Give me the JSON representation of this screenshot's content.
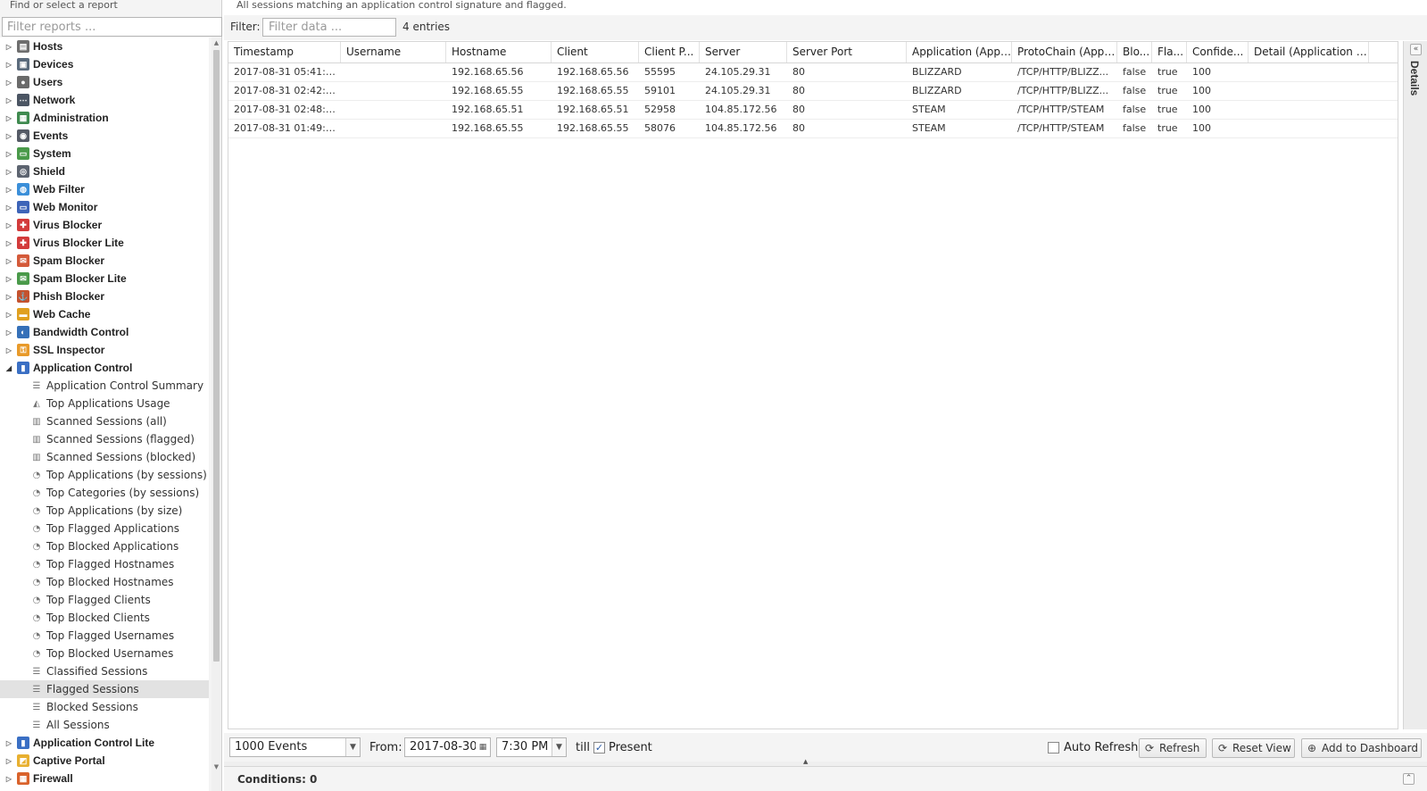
{
  "left_panel": {
    "header": "Find or select a report",
    "filter_placeholder": "Filter reports ..."
  },
  "tree_top": [
    {
      "label": "Hosts",
      "icon": "hosts-icon",
      "color": "#6e6e6e",
      "glyph": "▤"
    },
    {
      "label": "Devices",
      "icon": "devices-icon",
      "color": "#5b6b7c",
      "glyph": "▣"
    },
    {
      "label": "Users",
      "icon": "users-icon",
      "color": "#6a6a6a",
      "glyph": "●"
    },
    {
      "label": "Network",
      "icon": "network-icon",
      "color": "#4b5563",
      "glyph": "⋯"
    },
    {
      "label": "Administration",
      "icon": "administration-icon",
      "color": "#3f8a4f",
      "glyph": "▦"
    },
    {
      "label": "Events",
      "icon": "events-icon",
      "color": "#555b66",
      "glyph": "◉"
    },
    {
      "label": "System",
      "icon": "system-icon",
      "color": "#4a9a4a",
      "glyph": "▭"
    },
    {
      "label": "Shield",
      "icon": "shield-icon",
      "color": "#5d6470",
      "glyph": "◎"
    },
    {
      "label": "Web Filter",
      "icon": "web-filter-icon",
      "color": "#3b8fd9",
      "glyph": "◍"
    },
    {
      "label": "Web Monitor",
      "icon": "web-monitor-icon",
      "color": "#3d64b8",
      "glyph": "▭"
    },
    {
      "label": "Virus Blocker",
      "icon": "virus-blocker-icon",
      "color": "#d33b3b",
      "glyph": "✚"
    },
    {
      "label": "Virus Blocker Lite",
      "icon": "virus-blocker-lite-icon",
      "color": "#d33b3b",
      "glyph": "✚"
    },
    {
      "label": "Spam Blocker",
      "icon": "spam-blocker-icon",
      "color": "#d45a3a",
      "glyph": "✉"
    },
    {
      "label": "Spam Blocker Lite",
      "icon": "spam-blocker-lite-icon",
      "color": "#4a9a4a",
      "glyph": "✉"
    },
    {
      "label": "Phish Blocker",
      "icon": "phish-blocker-icon",
      "color": "#c4522e",
      "glyph": "⚓"
    },
    {
      "label": "Web Cache",
      "icon": "web-cache-icon",
      "color": "#e0a020",
      "glyph": "▬"
    },
    {
      "label": "Bandwidth Control",
      "icon": "bandwidth-control-icon",
      "color": "#3570b8",
      "glyph": "◐"
    },
    {
      "label": "SSL Inspector",
      "icon": "ssl-inspector-icon",
      "color": "#e89a2a",
      "glyph": "⚿"
    },
    {
      "label": "Application Control",
      "icon": "application-control-icon",
      "color": "#3a6fc4",
      "glyph": "▮",
      "expanded": true
    }
  ],
  "tree_children": [
    {
      "label": "Application Control Summary",
      "icon": "text-report-icon",
      "glyph": "☰"
    },
    {
      "label": "Top Applications Usage",
      "icon": "area-chart-icon",
      "glyph": "◭"
    },
    {
      "label": "Scanned Sessions (all)",
      "icon": "bar-chart-icon",
      "glyph": "▥"
    },
    {
      "label": "Scanned Sessions (flagged)",
      "icon": "bar-chart-icon",
      "glyph": "▥"
    },
    {
      "label": "Scanned Sessions (blocked)",
      "icon": "bar-chart-icon",
      "glyph": "▥"
    },
    {
      "label": "Top Applications (by sessions)",
      "icon": "pie-chart-icon",
      "glyph": "◔"
    },
    {
      "label": "Top Categories (by sessions)",
      "icon": "pie-chart-icon",
      "glyph": "◔"
    },
    {
      "label": "Top Applications (by size)",
      "icon": "pie-chart-icon",
      "glyph": "◔"
    },
    {
      "label": "Top Flagged Applications",
      "icon": "pie-chart-icon",
      "glyph": "◔"
    },
    {
      "label": "Top Blocked Applications",
      "icon": "pie-chart-icon",
      "glyph": "◔"
    },
    {
      "label": "Top Flagged Hostnames",
      "icon": "pie-chart-icon",
      "glyph": "◔"
    },
    {
      "label": "Top Blocked Hostnames",
      "icon": "pie-chart-icon",
      "glyph": "◔"
    },
    {
      "label": "Top Flagged Clients",
      "icon": "pie-chart-icon",
      "glyph": "◔"
    },
    {
      "label": "Top Blocked Clients",
      "icon": "pie-chart-icon",
      "glyph": "◔"
    },
    {
      "label": "Top Flagged Usernames",
      "icon": "pie-chart-icon",
      "glyph": "◔"
    },
    {
      "label": "Top Blocked Usernames",
      "icon": "pie-chart-icon",
      "glyph": "◔"
    },
    {
      "label": "Classified Sessions",
      "icon": "list-report-icon",
      "glyph": "☰"
    },
    {
      "label": "Flagged Sessions",
      "icon": "list-report-icon",
      "glyph": "☰",
      "selected": true
    },
    {
      "label": "Blocked Sessions",
      "icon": "list-report-icon",
      "glyph": "☰"
    },
    {
      "label": "All Sessions",
      "icon": "list-report-icon",
      "glyph": "☰"
    }
  ],
  "tree_bottom": [
    {
      "label": "Application Control Lite",
      "icon": "application-control-lite-icon",
      "color": "#3a6fc4",
      "glyph": "▮"
    },
    {
      "label": "Captive Portal",
      "icon": "captive-portal-icon",
      "color": "#e8b030",
      "glyph": "◩"
    },
    {
      "label": "Firewall",
      "icon": "firewall-icon",
      "color": "#d9622b",
      "glyph": "▦"
    }
  ],
  "report": {
    "description": "All sessions matching an application control signature and flagged.",
    "filter_label": "Filter:",
    "filter_placeholder": "Filter data ...",
    "entries": "4 entries"
  },
  "grid": {
    "columns": [
      "Timestamp",
      "Username",
      "Hostname",
      "Client",
      "Client P...",
      "Server",
      "Server Port",
      "Application (Appli...",
      "ProtoChain (Appli...",
      "Blo...",
      "Fla...",
      "Confide...",
      "Detail (Application C..."
    ],
    "rows": [
      [
        "2017-08-31 05:41:4...",
        "",
        "192.168.65.56",
        "192.168.65.56",
        "55595",
        "24.105.29.31",
        "80",
        "BLIZZARD",
        "/TCP/HTTP/BLIZZ...",
        "false",
        "true",
        "100",
        ""
      ],
      [
        "2017-08-31 02:42:5...",
        "",
        "192.168.65.55",
        "192.168.65.55",
        "59101",
        "24.105.29.31",
        "80",
        "BLIZZARD",
        "/TCP/HTTP/BLIZZ...",
        "false",
        "true",
        "100",
        ""
      ],
      [
        "2017-08-31 02:48:2...",
        "",
        "192.168.65.51",
        "192.168.65.51",
        "52958",
        "104.85.172.56",
        "80",
        "STEAM",
        "/TCP/HTTP/STEAM",
        "false",
        "true",
        "100",
        ""
      ],
      [
        "2017-08-31 01:49:4...",
        "",
        "192.168.65.55",
        "192.168.65.55",
        "58076",
        "104.85.172.56",
        "80",
        "STEAM",
        "/TCP/HTTP/STEAM",
        "false",
        "true",
        "100",
        ""
      ]
    ]
  },
  "details": {
    "label": "Details"
  },
  "toolbar": {
    "events_select": "1000 Events",
    "from_label": "From:",
    "from_date": "2017-08-30",
    "from_time": "7:30 PM",
    "till_label": "till",
    "present_label": "Present",
    "present_checked": true,
    "auto_refresh_label": "Auto Refresh",
    "auto_refresh_checked": false,
    "refresh_label": "Refresh",
    "reset_view_label": "Reset View",
    "add_to_dashboard_label": "Add to Dashboard"
  },
  "conditions": {
    "label": "Conditions: 0"
  }
}
